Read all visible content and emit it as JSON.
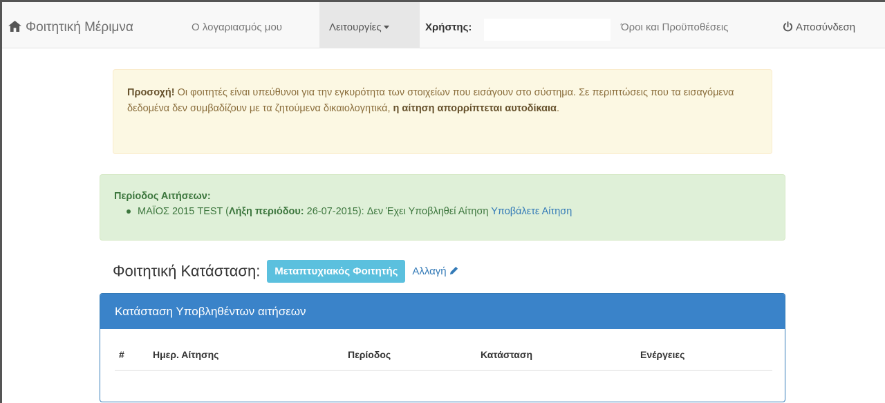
{
  "navbar": {
    "brand": "Φοιτητική Μέριμνα",
    "brand_icon": "home-icon",
    "my_account": "Ο λογαριασμός μου",
    "functions": "Λειτουργίες",
    "user_label": "Χρήστης:",
    "terms": "Όροι και Προϋποθέσεις",
    "logout": "Αποσύνδεση",
    "logout_icon": "power-icon"
  },
  "warning": {
    "strong": "Προσοχή!",
    "text": " Οι φοιτητές είναι υπεύθυνοι για την εγκυρότητα των στοιχείων που εισάγουν στο σύστημα. Σε περιπτώσεις που τα εισαγόμενα δεδομένα δεν συμβαδίζουν με τα ζητούμενα δικαιολογητικά, ",
    "strong_end": "η αίτηση απορρίπτεται αυτοδίκαια",
    "end": "."
  },
  "periods": {
    "title": "Περίοδος Αιτήσεων:",
    "items": [
      {
        "name": "ΜΑΪΟΣ 2015 TEST (",
        "end_label": "Λήξη περιόδου:",
        "end_date": " 26-07-2015): Δεν Έχει Υποβληθεί Αίτηση ",
        "action": "Υποβάλετε Αίτηση"
      }
    ]
  },
  "status": {
    "title": "Φοιτητική Κατάσταση:",
    "badge": "Μεταπτυχιακός Φοιτητής",
    "change": "Αλλαγή"
  },
  "panel": {
    "title": "Κατάσταση Υποβληθέντων αιτήσεων",
    "columns": [
      "#",
      "Ημερ. Αίτησης",
      "Περίοδος",
      "Κατάσταση",
      "Ενέργειες"
    ]
  },
  "colors": {
    "warning_bg": "#fcf8e3",
    "success_bg": "#dff0d8",
    "badge_bg": "#5bc0de",
    "panel_primary": "#3a83c9",
    "link": "#337ab7"
  }
}
